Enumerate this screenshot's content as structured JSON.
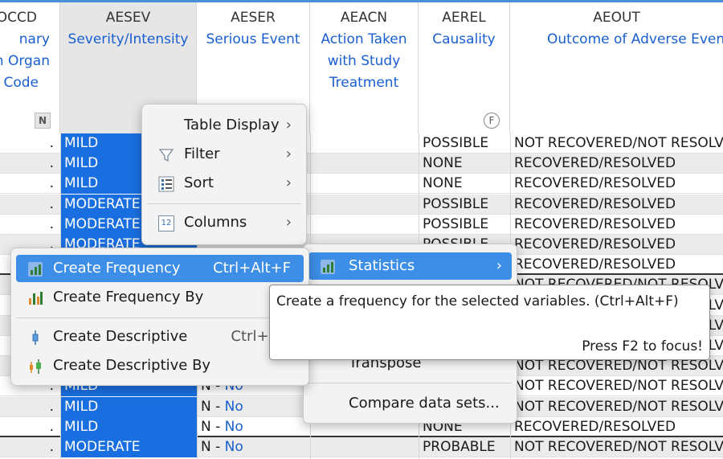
{
  "columns": [
    {
      "code": "OCCD",
      "label_lines": [
        "nary",
        "n Organ",
        "Code"
      ],
      "icon": "numeric-icon"
    },
    {
      "code": "AESEV",
      "label_lines": [
        "Severity/Intensity"
      ]
    },
    {
      "code": "AESER",
      "label_lines": [
        "Serious Event"
      ]
    },
    {
      "code": "AEACN",
      "label_lines": [
        "Action Taken",
        "with Study",
        "Treatment"
      ]
    },
    {
      "code": "AEREL",
      "label_lines": [
        "Causality"
      ],
      "icon": "format-icon"
    },
    {
      "code": "AEOUT",
      "label_lines": [
        "Outcome of Adverse Even"
      ]
    }
  ],
  "header_icons": {
    "numeric": "N",
    "format": "F"
  },
  "rows": [
    {
      "dot": ".",
      "sev": "MILD",
      "ser": "",
      "acn": "",
      "rel": "POSSIBLE",
      "out": "NOT RECOVERED/NOT RESOLV"
    },
    {
      "dot": ".",
      "sev": "MILD",
      "ser": "",
      "acn": "",
      "rel": "NONE",
      "out": "RECOVERED/RESOLVED"
    },
    {
      "dot": ".",
      "sev": "MILD",
      "ser": "",
      "acn": "",
      "rel": "NONE",
      "out": "RECOVERED/RESOLVED"
    },
    {
      "dot": ".",
      "sev": "MODERATE",
      "ser": "",
      "acn": "",
      "rel": "POSSIBLE",
      "out": "RECOVERED/RESOLVED"
    },
    {
      "dot": ".",
      "sev": "MODERATE",
      "ser": "",
      "acn": "",
      "rel": "POSSIBLE",
      "out": "RECOVERED/RESOLVED"
    },
    {
      "dot": ".",
      "sev": "MODERATE",
      "ser": "",
      "acn": "",
      "rel": "POSSIBLE",
      "out": "RECOVERED/RESOLVED"
    },
    {
      "dot": ".",
      "sev": "",
      "ser": "",
      "acn": "",
      "rel": "",
      "out": "RECOVERED/RESOLVED"
    },
    {
      "dot": ".",
      "sev": "",
      "ser": "",
      "acn": "",
      "rel": "",
      "out": "NOT RECOVERED/NOT RESOLV"
    },
    {
      "dot": ".",
      "sev": "",
      "ser": "",
      "acn": "",
      "rel": "",
      "out": "NOT RECOVERED/NOT RESOLV"
    },
    {
      "dot": ".",
      "sev": "",
      "ser": "",
      "acn": "",
      "rel": "",
      "out": "NOT RECOVERED/NOT RESOLV"
    },
    {
      "dot": ".",
      "sev": "",
      "ser": "",
      "acn": "",
      "rel": "",
      "out": "NOT RECOVERED/NOT RESOLV"
    },
    {
      "dot": ".",
      "sev": "",
      "ser": "",
      "acn": "",
      "rel": "",
      "out": "NOT RECOVERED/NOT RESOLV"
    },
    {
      "dot": ".",
      "sev": "MILD",
      "ser_prefix": "N - ",
      "ser_val": "No",
      "acn": "",
      "rel": "",
      "out": "NOT RECOVERED/NOT RESOLV"
    },
    {
      "dot": ".",
      "sev": "MILD",
      "ser_prefix": "N - ",
      "ser_val": "No",
      "acn": "",
      "rel": "",
      "out": "NOT RECOVERED/NOT RESOLV"
    },
    {
      "dot": ".",
      "sev": "MILD",
      "ser_prefix": "N - ",
      "ser_val": "No",
      "acn": "",
      "rel": "NONE",
      "out": "RECOVERED/RESOLVED"
    },
    {
      "dot": ".",
      "sev": "MODERATE",
      "ser_prefix": "N - ",
      "ser_val": "No",
      "acn": "",
      "rel": "PROBABLE",
      "out": "NOT RECOVERED/NOT RESOLV"
    }
  ],
  "context_menu": {
    "items": [
      {
        "label": "Table Display",
        "icon": "",
        "arrow": "›"
      },
      {
        "label": "Filter",
        "icon": "filter-icon",
        "arrow": "›"
      },
      {
        "label": "Sort",
        "icon": "sort-icon",
        "arrow": "›"
      },
      {
        "label": "Columns",
        "icon": "columns-icon",
        "arrow": "›",
        "icon_text": "12"
      }
    ]
  },
  "submenu": {
    "items": [
      {
        "label": "Statistics",
        "icon": "statistics-icon",
        "arrow": "›",
        "highlighted": true
      },
      {
        "label": "Transpose"
      },
      {
        "label": "Compare data sets..."
      }
    ]
  },
  "stats_menu": {
    "items": [
      {
        "label": "Create Frequency",
        "shortcut": "Ctrl+Alt+F",
        "icon": "frequency-icon",
        "highlighted": true
      },
      {
        "label": "Create Frequency By",
        "shortcut": "",
        "icon": "frequency-by-icon"
      },
      {
        "label": "Create Descriptive",
        "shortcut": "Ctrl+Alt+",
        "icon": "descriptive-icon"
      },
      {
        "label": "Create Descriptive By",
        "shortcut": "",
        "icon": "descriptive-by-icon"
      }
    ]
  },
  "tooltip": {
    "text": "Create a frequency for the selected variables. (Ctrl+Alt+F)",
    "hint": "Press F2 to focus!"
  },
  "colors": {
    "selection": "#1a6fe0",
    "highlight": "#3d8ee6",
    "label": "#1a5fd0"
  }
}
